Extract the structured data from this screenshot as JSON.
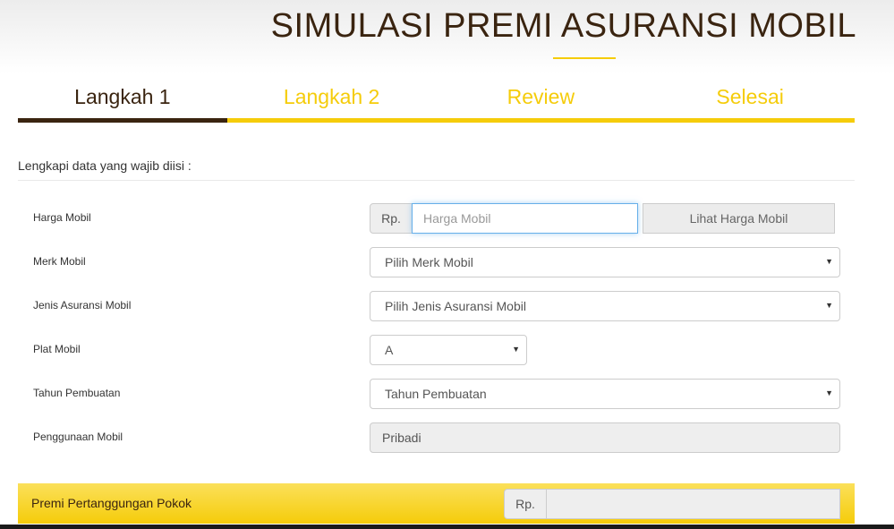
{
  "header": {
    "title": "SIMULASI PREMI ASURANSI MOBIL",
    "accent_color": "#f5cc0a",
    "active_color": "#3a2410"
  },
  "steps": [
    {
      "label": "Langkah 1",
      "active": true
    },
    {
      "label": "Langkah 2",
      "active": false
    },
    {
      "label": "Review",
      "active": false
    },
    {
      "label": "Selesai",
      "active": false
    }
  ],
  "form": {
    "intro": "Lengkapi data yang wajib diisi :",
    "harga_mobil": {
      "label": "Harga Mobil",
      "prefix": "Rp.",
      "value": "",
      "placeholder": "Harga Mobil",
      "button_label": "Lihat Harga Mobil"
    },
    "merk_mobil": {
      "label": "Merk Mobil",
      "selected": "Pilih Merk Mobil"
    },
    "jenis_asuransi": {
      "label": "Jenis Asuransi Mobil",
      "selected": "Pilih Jenis Asuransi Mobil"
    },
    "plat_mobil": {
      "label": "Plat Mobil",
      "selected": "A"
    },
    "tahun_pembuatan": {
      "label": "Tahun Pembuatan",
      "selected": "Tahun Pembuatan"
    },
    "penggunaan_mobil": {
      "label": "Penggunaan Mobil",
      "value": "Pribadi"
    }
  },
  "premi": {
    "label": "Premi Pertanggungan Pokok",
    "prefix": "Rp.",
    "value": ""
  },
  "icons": {
    "select_caret": "▼"
  }
}
